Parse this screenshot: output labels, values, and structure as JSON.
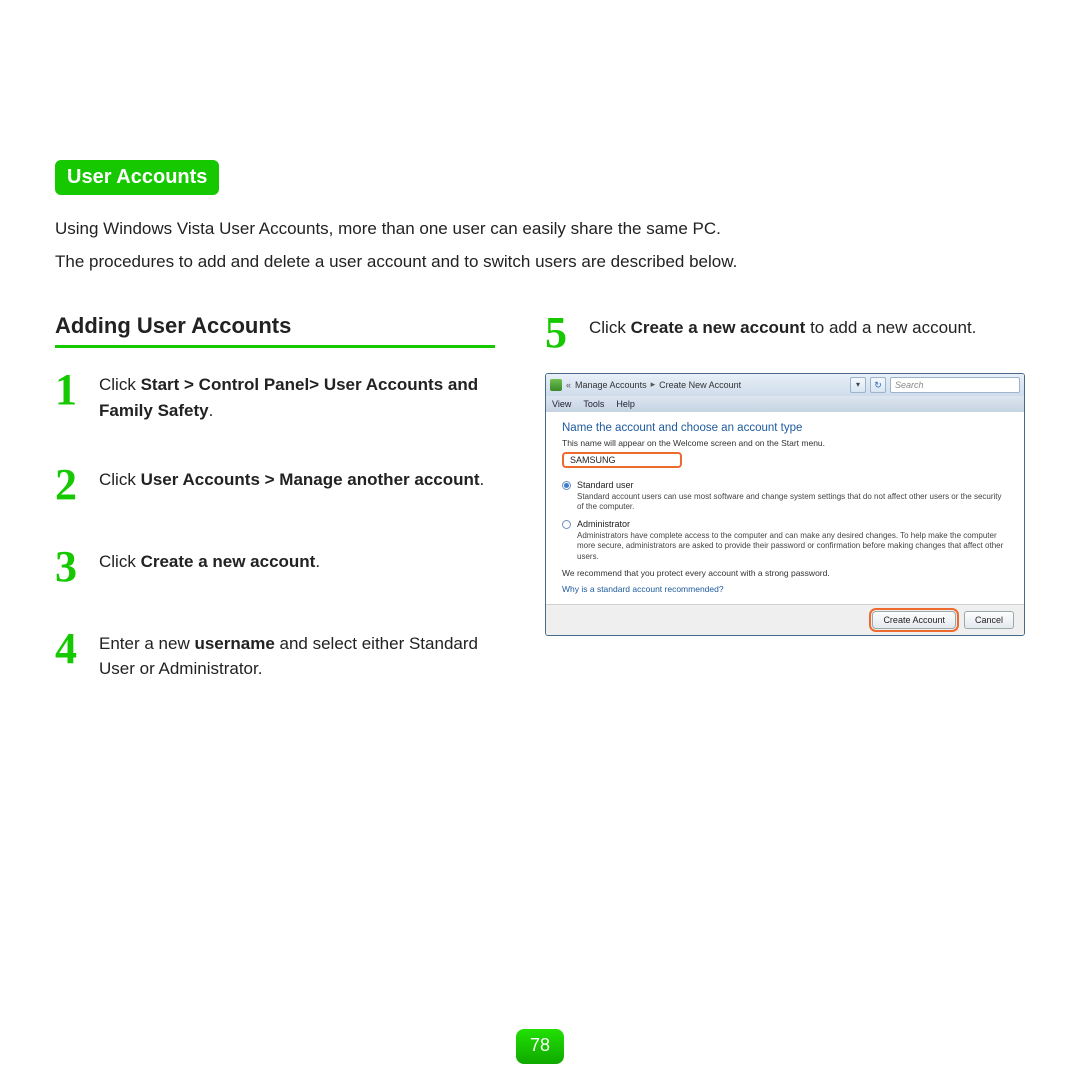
{
  "section_title": "User Accounts",
  "intro": {
    "p1": "Using Windows Vista User Accounts, more than one user can easily share the same PC.",
    "p2": "The procedures to add and delete a user account and to switch users are described below."
  },
  "sub_heading": "Adding User Accounts",
  "steps_left": [
    {
      "num": "1",
      "prefix": "Click ",
      "bold": "Start > Control Panel> User Accounts and Family Safety",
      "suffix": "."
    },
    {
      "num": "2",
      "prefix": "Click ",
      "bold": "User Accounts > Manage another account",
      "suffix": "."
    },
    {
      "num": "3",
      "prefix": "Click ",
      "bold": "Create a new account",
      "suffix": "."
    },
    {
      "num": "4",
      "prefix": "Enter a new ",
      "bold": "username",
      "suffix": " and select either Standard User or Administrator."
    }
  ],
  "step5": {
    "num": "5",
    "prefix": "Click ",
    "bold": "Create a new account",
    "suffix": " to add a new account."
  },
  "vista": {
    "breadcrumb": {
      "chev": "«",
      "a": "Manage Accounts",
      "sep": "▸",
      "b": "Create New Account"
    },
    "drop_glyph": "▾",
    "refresh_glyph": "↻",
    "search_placeholder": "Search",
    "menu": {
      "view": "View",
      "tools": "Tools",
      "help": "Help"
    },
    "title": "Name the account and choose an account type",
    "sub": "This name will appear on the Welcome screen and on the Start menu.",
    "input_value": "SAMSUNG",
    "opt1": {
      "label": "Standard user",
      "desc": "Standard account users can use most software and change system settings that do not affect other users or the security of the computer."
    },
    "opt2": {
      "label": "Administrator",
      "desc": "Administrators have complete access to the computer and can make any desired changes. To help make the computer more secure, administrators are asked to provide their password or confirmation before making changes that affect other users."
    },
    "recommend": "We recommend that you protect every account with a strong password.",
    "link": "Why is a standard account recommended?",
    "btn_create": "Create Account",
    "btn_cancel": "Cancel"
  },
  "page_number": "78"
}
